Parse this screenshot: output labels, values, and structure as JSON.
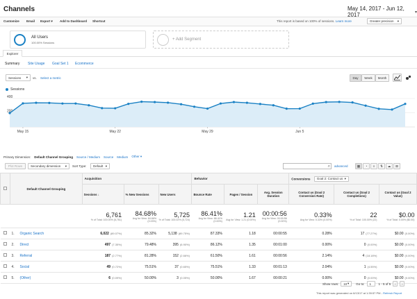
{
  "header": {
    "title": "Channels",
    "date_range": "May 14, 2017 - Jun 12, 2017"
  },
  "toolbar": {
    "items": [
      "Customize",
      "Email",
      "Export",
      "Add to Dashboard",
      "Shortcut"
    ],
    "sample_note": "This report is based on 100% of sessions.",
    "learn_more": "Learn more",
    "precision": "Greater precision"
  },
  "segments": {
    "all_users_title": "All Users",
    "all_users_sub": "100.00% Sessions",
    "add_segment": "+ Add Segment"
  },
  "tabs": {
    "explorer": "Explorer",
    "subtabs": [
      "Summary",
      "Site Usage",
      "Goal Set 1",
      "Ecommerce"
    ]
  },
  "chart_controls": {
    "metric": "Sessions",
    "vs": "vs.",
    "select_metric": "Select a metric",
    "granularity": [
      "Day",
      "Week",
      "Month"
    ]
  },
  "chart_data": {
    "type": "line",
    "legend": "Sessions",
    "ylim": [
      0,
      400
    ],
    "yticks": [
      {
        "label": "400",
        "value": 400
      },
      {
        "label": "200",
        "value": 200
      }
    ],
    "xticks": [
      {
        "label": "May 15",
        "index": 1
      },
      {
        "label": "May 22",
        "index": 8
      },
      {
        "label": "May 29",
        "index": 15
      },
      {
        "label": "Jun 5",
        "index": 22
      }
    ],
    "series": [
      {
        "values": [
          195,
          332,
          340,
          338,
          330,
          330,
          305,
          265,
          263,
          325,
          355,
          350,
          342,
          320,
          285,
          258,
          330,
          350,
          340,
          323,
          305,
          257,
          258,
          328,
          350,
          353,
          345,
          300,
          255,
          245,
          325
        ]
      }
    ],
    "color": "#1a81c4"
  },
  "dimension": {
    "label": "Primary Dimension:",
    "options": [
      "Default Channel Grouping",
      "Source / Medium",
      "Source",
      "Medium",
      "Other"
    ]
  },
  "table_controls": {
    "plot_rows": "Plot Rows",
    "secondary": "Secondary dimension",
    "sort_type_label": "Sort Type:",
    "sort_type": "Default",
    "advanced": "advanced"
  },
  "table": {
    "group_headers": {
      "acquisition": "Acquisition",
      "behavior": "Behavior",
      "conversions": "Conversions",
      "goal": "Goal 2: Contact us"
    },
    "dimension_header": "Default Channel Grouping",
    "columns": [
      "Sessions",
      "% New Sessions",
      "New Users",
      "Bounce Rate",
      "Pages / Session",
      "Avg. Session Duration",
      "Contact us (Goal 2 Conversion Rate)",
      "Contact us (Goal 2 Completions)",
      "Contact us (Goal 2 Value)"
    ],
    "totals": [
      {
        "value": "6,761",
        "sub": "% of Total: 100.00% (6,761)"
      },
      {
        "value": "84.68%",
        "sub": "Avg for View: 84.66% (0.03%)"
      },
      {
        "value": "5,725",
        "sub": "% of Total: 100.02% (5,724)"
      },
      {
        "value": "86.41%",
        "sub": "Avg for View: 86.41% (0.00%)"
      },
      {
        "value": "1.21",
        "sub": "Avg for View: 1.21 (0.00%)"
      },
      {
        "value": "00:00:56",
        "sub": "Avg for View: 00:00:56 (0.00%)"
      },
      {
        "value": "0.33%",
        "sub": "Avg for View: 0.33% (0.00%)"
      },
      {
        "value": "22",
        "sub": "% of Total: 100.00% (22)"
      },
      {
        "value": "$0.00",
        "sub": "% of Total: 0.00% ($0.00)"
      }
    ],
    "rows": [
      {
        "n": "1.",
        "name": "Organic Search",
        "sessions": "6,022",
        "sessions_pct": "(89.07%)",
        "new_sessions": "85.32%",
        "new_users": "5,138",
        "new_users_pct": "(89.75%)",
        "bounce": "87.33%",
        "pages": "1.18",
        "duration": "00:00:55",
        "conv_rate": "0.28%",
        "completions": "17",
        "completions_pct": "(77.27%)",
        "value": "$0.00",
        "value_pct": "(0.00%)"
      },
      {
        "n": "2.",
        "name": "Direct",
        "sessions": "497",
        "sessions_pct": "(7.35%)",
        "new_sessions": "79.48%",
        "new_users": "395",
        "new_users_pct": "(6.90%)",
        "bounce": "86.12%",
        "pages": "1.35",
        "duration": "00:01:00",
        "conv_rate": "0.00%",
        "completions": "0",
        "completions_pct": "(0.00%)",
        "value": "$0.00",
        "value_pct": "(0.00%)"
      },
      {
        "n": "3.",
        "name": "Referral",
        "sessions": "187",
        "sessions_pct": "(2.77%)",
        "new_sessions": "81.28%",
        "new_users": "152",
        "new_users_pct": "(2.66%)",
        "bounce": "61.50%",
        "pages": "1.61",
        "duration": "00:00:56",
        "conv_rate": "2.14%",
        "completions": "4",
        "completions_pct": "(18.18%)",
        "value": "$0.00",
        "value_pct": "(0.00%)"
      },
      {
        "n": "4.",
        "name": "Social",
        "sessions": "49",
        "sessions_pct": "(0.72%)",
        "new_sessions": "75.51%",
        "new_users": "37",
        "new_users_pct": "(0.65%)",
        "bounce": "75.51%",
        "pages": "1.33",
        "duration": "00:01:13",
        "conv_rate": "2.04%",
        "completions": "1",
        "completions_pct": "(4.55%)",
        "value": "$0.00",
        "value_pct": "(0.00%)"
      },
      {
        "n": "5.",
        "name": "(Other)",
        "sessions": "6",
        "sessions_pct": "(0.09%)",
        "new_sessions": "50.00%",
        "new_users": "3",
        "new_users_pct": "(0.05%)",
        "bounce": "50.00%",
        "pages": "1.67",
        "duration": "00:00:21",
        "conv_rate": "0.00%",
        "completions": "0",
        "completions_pct": "(0.00%)",
        "value": "$0.00",
        "value_pct": "(0.00%)"
      }
    ]
  },
  "pagination": {
    "show_rows_label": "Show rows:",
    "show_rows": "10",
    "goto_label": "Go to:",
    "goto": "1",
    "range": "1 - 5 of 5"
  },
  "footer": {
    "generated": "This report was generated on 6/13/17 at 1:39:57 PM -",
    "refresh": "Refresh Report"
  },
  "colors": {
    "accent": "#1a81c4",
    "line": "#1a81c4",
    "fill": "#dcedf8"
  }
}
